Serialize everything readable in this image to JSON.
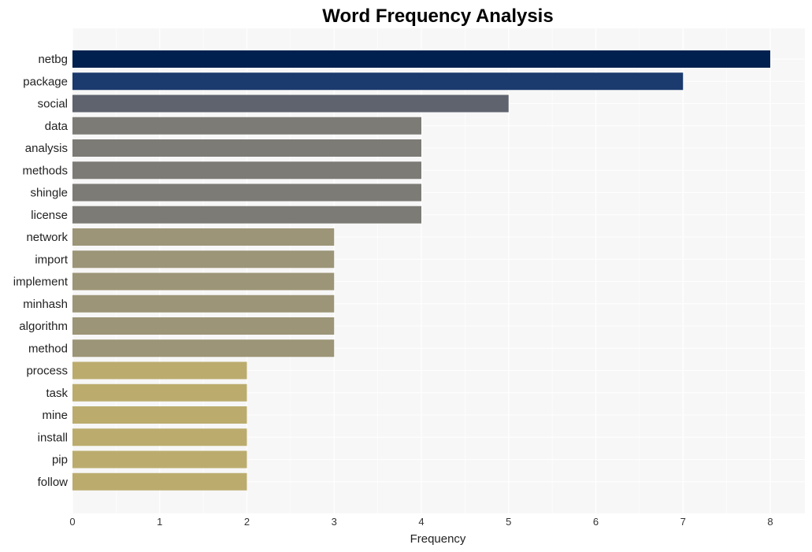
{
  "chart_data": {
    "type": "bar",
    "orientation": "horizontal",
    "title": "Word Frequency Analysis",
    "xlabel": "Frequency",
    "ylabel": "",
    "xlim": [
      0,
      8.4
    ],
    "xticks": [
      0,
      1,
      2,
      3,
      4,
      5,
      6,
      7,
      8
    ],
    "grid": true,
    "legend": "none",
    "categories": [
      "netbg",
      "package",
      "social",
      "data",
      "analysis",
      "methods",
      "shingle",
      "license",
      "network",
      "import",
      "implement",
      "minhash",
      "algorithm",
      "method",
      "process",
      "task",
      "mine",
      "install",
      "pip",
      "follow"
    ],
    "values": [
      8,
      7,
      5,
      4,
      4,
      4,
      4,
      4,
      3,
      3,
      3,
      3,
      3,
      3,
      2,
      2,
      2,
      2,
      2,
      2
    ],
    "colors": [
      "#00214f",
      "#1b3a6e",
      "#5e636e",
      "#7d7b76",
      "#7d7b76",
      "#7d7b76",
      "#7d7b76",
      "#7d7b76",
      "#9c9577",
      "#9c9577",
      "#9c9577",
      "#9c9577",
      "#9c9577",
      "#9c9577",
      "#bbac6e",
      "#bbac6e",
      "#bbac6e",
      "#bbac6e",
      "#bbac6e",
      "#bbac6e"
    ]
  }
}
